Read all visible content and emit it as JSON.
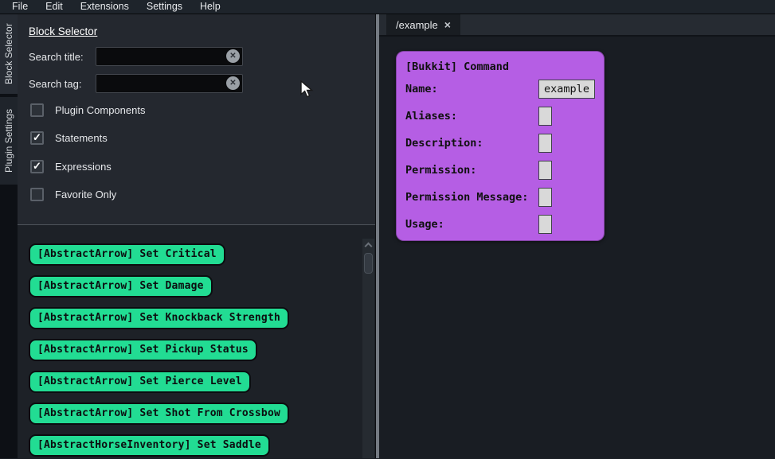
{
  "menubar": {
    "items": [
      "File",
      "Edit",
      "Extensions",
      "Settings",
      "Help"
    ]
  },
  "rail": {
    "tabs": [
      {
        "label": "Block Selector",
        "selected": true
      },
      {
        "label": "Plugin Settings",
        "selected": false
      }
    ]
  },
  "block_selector": {
    "heading": "Block Selector",
    "search_fields": [
      {
        "label": "Search title:",
        "value": "",
        "clear_icon": "✕"
      },
      {
        "label": "Search tag:",
        "value": "",
        "clear_icon": "✕"
      }
    ],
    "check_glyph": "✓",
    "filters": [
      {
        "label": "Plugin Components",
        "checked": false
      },
      {
        "label": "Statements",
        "checked": true
      },
      {
        "label": "Expressions",
        "checked": true
      },
      {
        "label": "Favorite Only",
        "checked": false
      }
    ],
    "blocks": [
      "[AbstractArrow] Set Critical",
      "[AbstractArrow] Set Damage",
      "[AbstractArrow] Set Knockback Strength",
      "[AbstractArrow] Set Pickup Status",
      "[AbstractArrow] Set Pierce Level",
      "[AbstractArrow] Set Shot From Crossbow",
      "[AbstractHorseInventory] Set Saddle"
    ]
  },
  "editor": {
    "tab_label": "/example",
    "tab_close": "×",
    "command_block": {
      "title": "[Bukkit] Command",
      "fields": [
        {
          "label": "Name:",
          "value": "example",
          "wide": true
        },
        {
          "label": "Aliases:",
          "value": "",
          "wide": false
        },
        {
          "label": "Description:",
          "value": "",
          "wide": false
        },
        {
          "label": "Permission:",
          "value": "",
          "wide": false
        },
        {
          "label": "Permission Message:",
          "value": "",
          "wide": false
        },
        {
          "label": "Usage:",
          "value": "",
          "wide": false
        }
      ]
    }
  },
  "colors": {
    "statement_green": "#22DC93",
    "command_purple": "#B55EE4"
  }
}
